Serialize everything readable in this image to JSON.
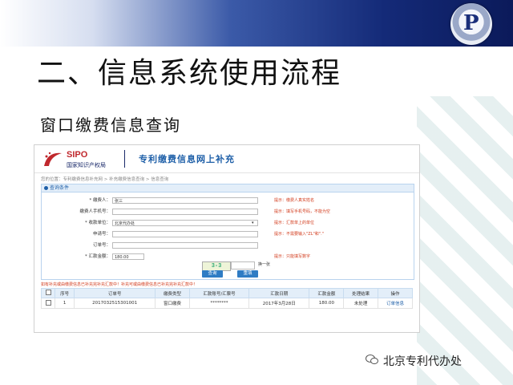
{
  "slide": {
    "title": "二、信息系统使用流程",
    "subtitle": "窗口缴费信息查询",
    "footer": "北京专利代办处"
  },
  "app": {
    "org_logo": "SIPO",
    "org_name": "国家知识产权局",
    "site_title": "专利缴费信息网上补充",
    "breadcrumb": "您的位置：专利缴费信息补充网 > 补充缴费信息查询 > 信息查询",
    "panel_title": "查询条件"
  },
  "form": {
    "fields": [
      {
        "label": "* 缴费人：",
        "value": "张三",
        "hint": "提示：缴费人真实姓名"
      },
      {
        "label": "缴费人手机号：",
        "value": "",
        "hint": "提示：填写手机号码，不能为空"
      },
      {
        "label": "* 收款单位：",
        "value": "北京代办处",
        "hint": "提示：汇款单上的单位"
      },
      {
        "label": "申请号：",
        "value": "",
        "hint": "提示：不需要输入\"ZL\"和\".\""
      },
      {
        "label": "订单号：",
        "value": "",
        "hint": ""
      },
      {
        "label": "* 汇款金额：",
        "value": "180.00",
        "hint": "提示：只能填写数字"
      }
    ],
    "captcha": "3-3",
    "captcha_refresh": "换一张",
    "search_button": "查询",
    "reset_button": "重填"
  },
  "warning": "如有补充或由缴费信息已补充完补充汇款中！补充可或由缴费信息已补充完补充汇款中！",
  "table": {
    "headers": [
      "序号",
      "订单号",
      "缴费类型",
      "汇款账号/汇票号",
      "汇款日期",
      "汇款金额",
      "处理结果",
      "操作"
    ],
    "rows": [
      {
        "index": "1",
        "order": "201703251530100​1",
        "type": "窗口缴费",
        "account": "********",
        "date": "2017年3月28日",
        "amount": "180.00",
        "result": "未处理",
        "action": "订单信息"
      }
    ]
  }
}
